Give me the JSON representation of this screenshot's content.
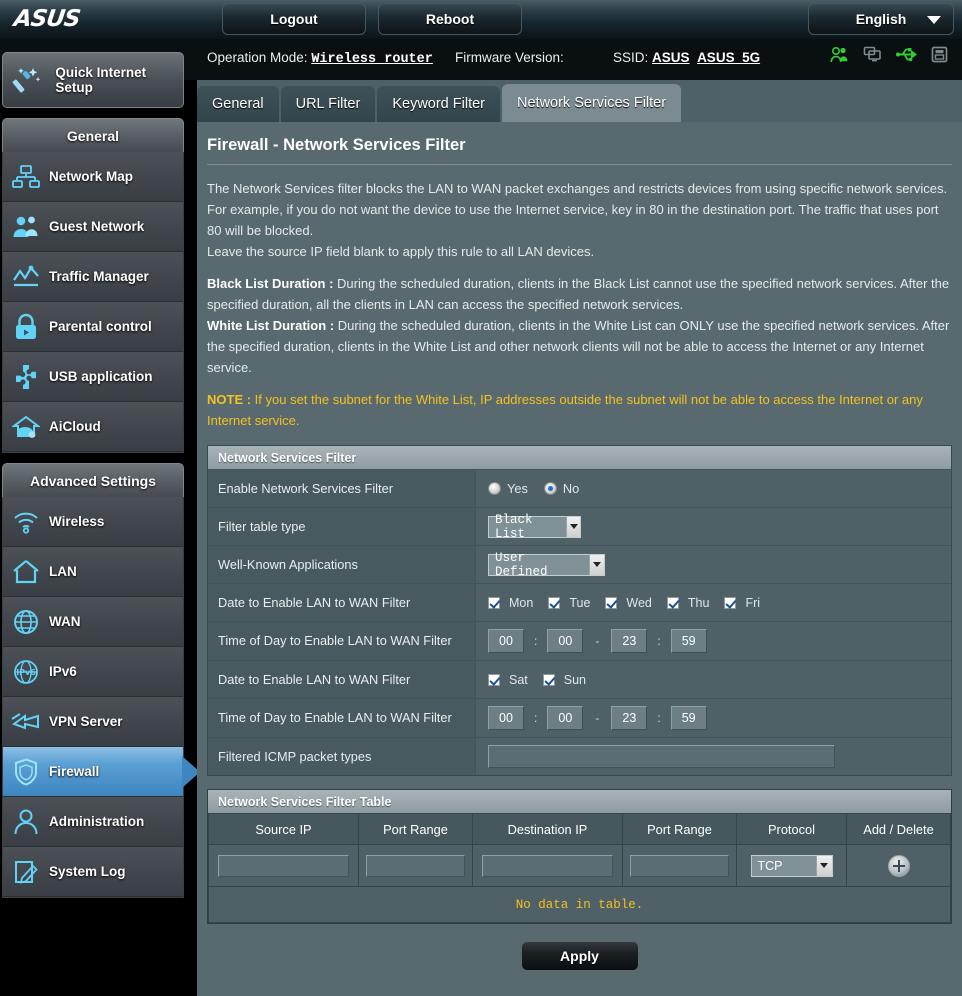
{
  "topbar": {
    "brand": "ASUS",
    "logout_label": "Logout",
    "reboot_label": "Reboot",
    "language_label": "English"
  },
  "header": {
    "operation_mode_label": "Operation Mode:",
    "operation_mode_value": "Wireless router",
    "firmware_label": "Firmware Version:",
    "firmware_value": "",
    "ssid_label": "SSID:",
    "ssid_1": "ASUS",
    "ssid_2": "ASUS_5G",
    "icons": [
      {
        "name": "clients-icon",
        "color": "#33cc33"
      },
      {
        "name": "devices-icon",
        "color": "#7d8a8f"
      },
      {
        "name": "usb-icon",
        "color": "#33cc33"
      },
      {
        "name": "printer-icon",
        "color": "#7d8a8f"
      }
    ]
  },
  "sidebar": {
    "quick_setup_label": "Quick Internet Setup",
    "general_header": "General",
    "general_items": [
      {
        "label": "Network Map",
        "icon": "network-map-icon"
      },
      {
        "label": "Guest Network",
        "icon": "guest-network-icon"
      },
      {
        "label": "Traffic Manager",
        "icon": "traffic-manager-icon"
      },
      {
        "label": "Parental control",
        "icon": "parental-control-icon"
      },
      {
        "label": "USB application",
        "icon": "usb-application-icon"
      },
      {
        "label": "AiCloud",
        "icon": "aicloud-icon"
      }
    ],
    "advanced_header": "Advanced Settings",
    "advanced_items": [
      {
        "label": "Wireless",
        "icon": "wireless-icon"
      },
      {
        "label": "LAN",
        "icon": "lan-icon"
      },
      {
        "label": "WAN",
        "icon": "wan-icon"
      },
      {
        "label": "IPv6",
        "icon": "ipv6-icon"
      },
      {
        "label": "VPN Server",
        "icon": "vpn-server-icon"
      },
      {
        "label": "Firewall",
        "icon": "firewall-icon"
      },
      {
        "label": "Administration",
        "icon": "administration-icon"
      },
      {
        "label": "System Log",
        "icon": "system-log-icon"
      }
    ],
    "active_item": "Firewall"
  },
  "tabs": [
    {
      "label": "General",
      "active": false
    },
    {
      "label": "URL Filter",
      "active": false
    },
    {
      "label": "Keyword Filter",
      "active": false
    },
    {
      "label": "Network Services Filter",
      "active": true
    }
  ],
  "page": {
    "title": "Firewall - Network Services Filter",
    "desc_p1": "The Network Services filter blocks the LAN to WAN packet exchanges and restricts devices from using specific network services. For example, if you do not want the device to use the Internet service, key in 80 in the destination port. The traffic that uses port 80 will be blocked.",
    "desc_p2": "Leave the source IP field blank to apply this rule to all LAN devices.",
    "black_list_term": "Black List Duration :",
    "black_list_text": " During the scheduled duration, clients in the Black List cannot use the specified network services. After the specified duration, all the clients in LAN can access the specified network services.",
    "white_list_term": "White List Duration :",
    "white_list_text": " During the scheduled duration, clients in the White List can ONLY use the specified network services. After the specified duration, clients in the White List and other network clients will not be able to access the Internet or any Internet service.",
    "note_term": "NOTE :",
    "note_text": " If you set the subnet for the White List, IP addresses outside the subnet will not be able to access the Internet or any Internet service."
  },
  "form": {
    "box_title": "Network Services Filter",
    "enable_label": "Enable Network Services Filter",
    "enable_yes": "Yes",
    "enable_no": "No",
    "enable_value": "No",
    "filter_table_type_label": "Filter table type",
    "filter_table_type_value": "Black List",
    "well_known_label": "Well-Known Applications",
    "well_known_value": "User Defined",
    "date_label_1": "Date to Enable LAN to WAN Filter",
    "days_weekday": [
      {
        "label": "Mon",
        "checked": true
      },
      {
        "label": "Tue",
        "checked": true
      },
      {
        "label": "Wed",
        "checked": true
      },
      {
        "label": "Thu",
        "checked": true
      },
      {
        "label": "Fri",
        "checked": true
      }
    ],
    "time_label_1": "Time of Day to Enable LAN to WAN Filter",
    "time_weekday": {
      "start_h": "00",
      "start_m": "00",
      "end_h": "23",
      "end_m": "59"
    },
    "date_label_2": "Date to Enable LAN to WAN Filter",
    "days_weekend": [
      {
        "label": "Sat",
        "checked": true
      },
      {
        "label": "Sun",
        "checked": true
      }
    ],
    "time_label_2": "Time of Day to Enable LAN to WAN Filter",
    "time_weekend": {
      "start_h": "00",
      "start_m": "00",
      "end_h": "23",
      "end_m": "59"
    },
    "icmp_label": "Filtered ICMP packet types",
    "icmp_value": ""
  },
  "table": {
    "box_title": "Network Services Filter Table",
    "columns": [
      "Source IP",
      "Port Range",
      "Destination IP",
      "Port Range",
      "Protocol",
      "Add / Delete"
    ],
    "new_row": {
      "source_ip": "",
      "source_port": "",
      "dest_ip": "",
      "dest_port": "",
      "protocol": "TCP"
    },
    "empty_message": "No data in table."
  },
  "footer": {
    "apply_label": "Apply"
  },
  "colors": {
    "accent_blue": "#3d86c0",
    "note_yellow": "#f5c11e",
    "panel_bg": "#58696f",
    "status_green": "#33cc33"
  }
}
